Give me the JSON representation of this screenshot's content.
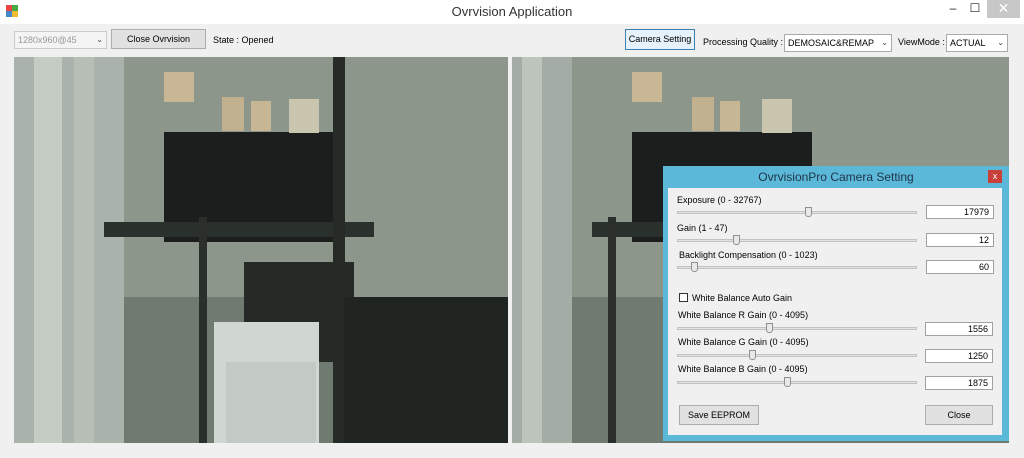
{
  "window": {
    "title": "Ovrvision Application",
    "minimize": "–",
    "maximize": "☐",
    "close": "✕"
  },
  "toolbar": {
    "resolution_value": "1280x960@45",
    "close_button": "Close Ovrvision",
    "state": "State : Opened",
    "camera_setting_button": "Camera Setting",
    "quality_label": "Processing Quality :",
    "quality_value": "DEMOSAIC&REMAP",
    "viewmode_label": "ViewMode :",
    "viewmode_value": "ACTUAL"
  },
  "dialog": {
    "title": "OvrvisionPro Camera Setting",
    "close_glyph": "x",
    "exposure": {
      "label": "Exposure (0 - 32767)",
      "value": "17979",
      "level": 0.55
    },
    "gain": {
      "label": "Gain (1 - 47)",
      "value": "12",
      "level": 0.24
    },
    "backlight": {
      "label": "Backlight Compensation (0 - 1023)",
      "value": "60",
      "level": 0.06
    },
    "wb_auto": {
      "label": "White Balance Auto Gain",
      "checked": false
    },
    "wb_r": {
      "label": "White Balance R Gain (0 - 4095)",
      "value": "1556",
      "level": 0.38
    },
    "wb_g": {
      "label": "White Balance G Gain (0 - 4095)",
      "value": "1250",
      "level": 0.31
    },
    "wb_b": {
      "label": "White Balance B Gain (0 - 4095)",
      "value": "1875",
      "level": 0.46
    },
    "save_button": "Save EEPROM",
    "close_button": "Close"
  },
  "colors": {
    "dialog_border": "#5bb8d8",
    "close_red": "#c9403a"
  }
}
